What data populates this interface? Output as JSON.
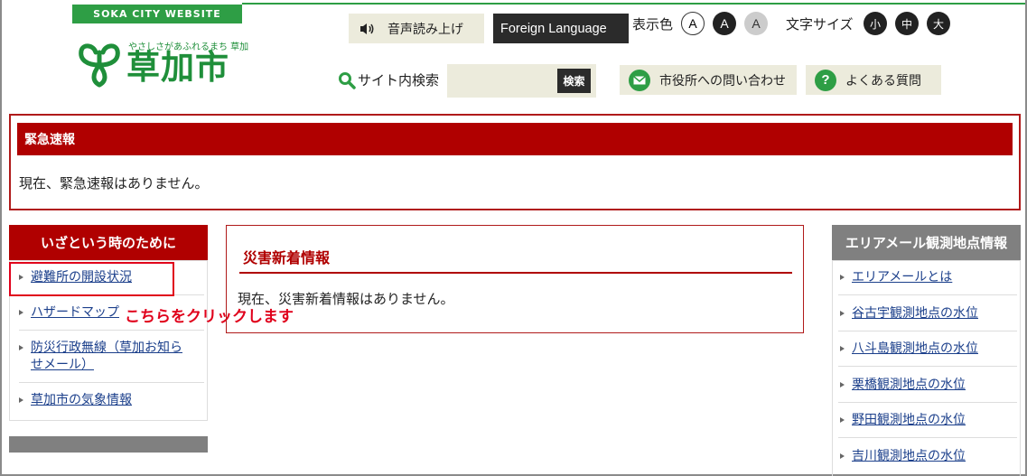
{
  "header": {
    "site_tag": "SOKA CITY WEBSITE",
    "logo_tagline": "やさしさがあふれるまち 草加",
    "logo_name": "草加市",
    "voice_button": "音声読み上げ",
    "foreign_button": "Foreign Language",
    "color_label": "表示色",
    "color_options": [
      "A",
      "A",
      "A"
    ],
    "size_label": "文字サイズ",
    "size_options": [
      "小",
      "中",
      "大"
    ],
    "search_label": "サイト内検索",
    "search_value": "",
    "search_button": "検索",
    "contact_button": "市役所への問い合わせ",
    "faq_button": "よくある質問"
  },
  "emergency": {
    "title": "緊急速報",
    "body": "現在、緊急速報はありません。"
  },
  "left_panel": {
    "title": "いざという時のために",
    "items": [
      "避難所の開設状況",
      "ハザードマップ",
      "防災行政無線（草加お知らせメール）",
      "草加市の気象情報"
    ],
    "annotation": "こちらをクリックします"
  },
  "center_panel": {
    "title": "災害新着情報",
    "body": "現在、災害新着情報はありません。"
  },
  "right_panel": {
    "title": "エリアメール観測地点情報",
    "items": [
      "エリアメールとは",
      "谷古宇観測地点の水位",
      "八斗島観測地点の水位",
      "栗橋観測地点の水位",
      "野田観測地点の水位",
      "吉川観測地点の水位"
    ]
  },
  "colors": {
    "brand_green": "#2e9e45",
    "alert_red": "#b00000",
    "highlight_red": "#e0001b"
  }
}
